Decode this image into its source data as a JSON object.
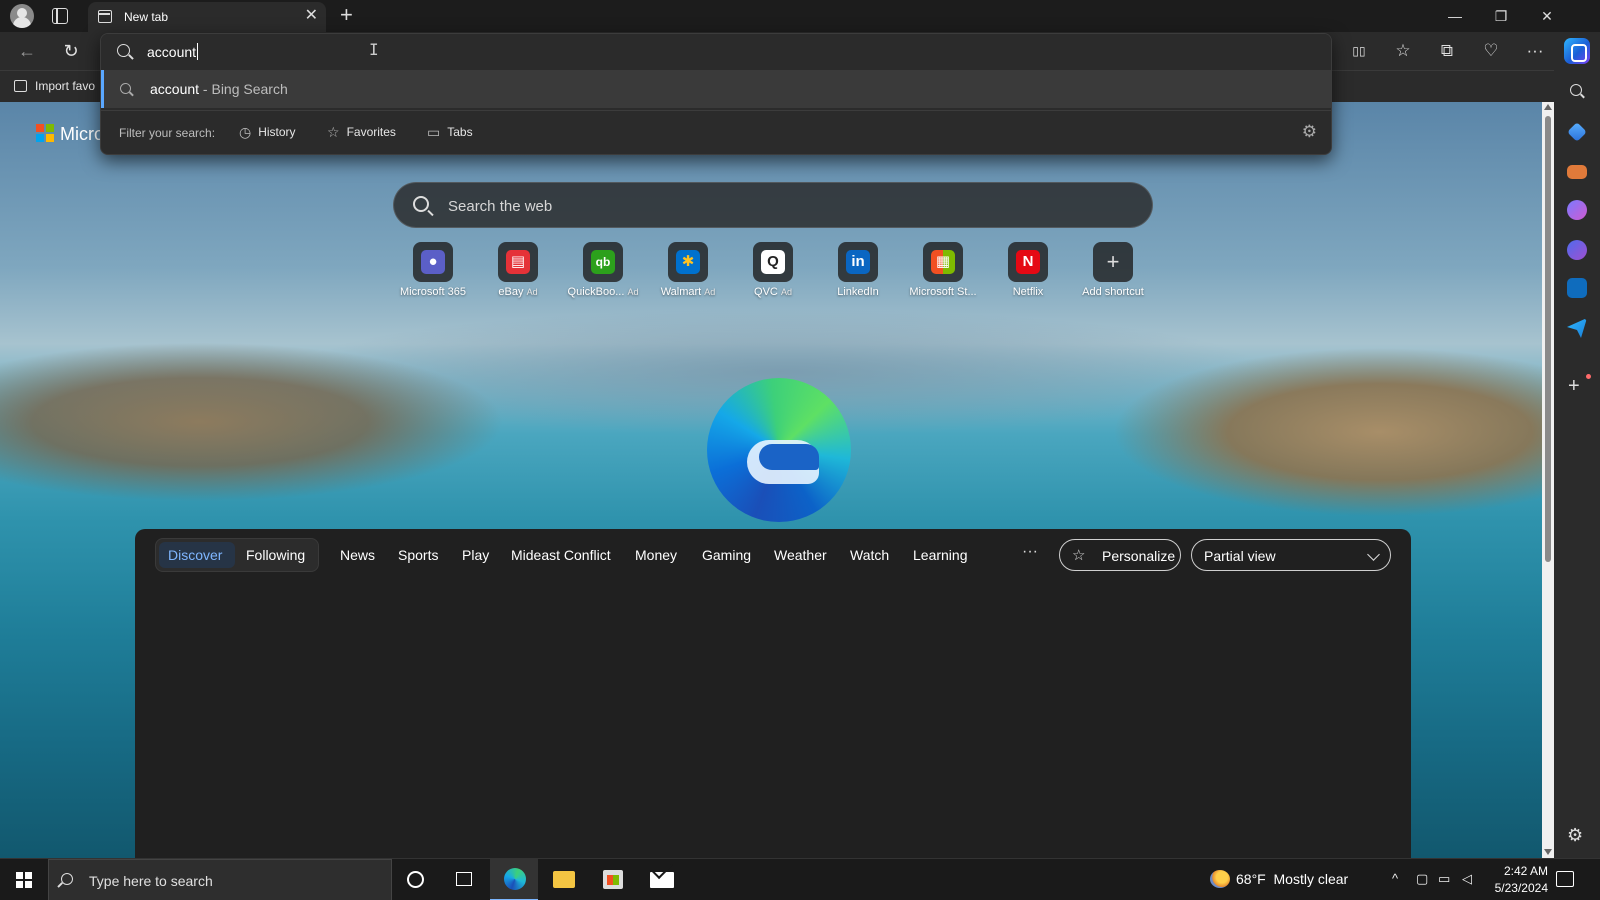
{
  "browser": {
    "tab_title": "New tab",
    "tab_close": "✕",
    "new_tab": "+",
    "window_controls": {
      "minimize": "—",
      "restore": "❐",
      "close": "✕"
    }
  },
  "toolbar": {
    "back_icon": "←",
    "refresh_icon": "↻",
    "split_screen_icon": "▯▯",
    "favorites_icon": "☆",
    "collections_icon": "⧉",
    "performance_icon": "♡",
    "more_icon": "···"
  },
  "favorites_bar": {
    "import_label": "Import favo"
  },
  "omnibox": {
    "value": "account",
    "suggestion_query": "account",
    "suggestion_suffix": " - Bing Search",
    "filter_label": "Filter your search:",
    "filters": [
      {
        "icon": "◷",
        "label": "History"
      },
      {
        "icon": "☆",
        "label": "Favorites"
      },
      {
        "icon": "▭",
        "label": "Tabs"
      }
    ],
    "settings_icon": "⚙"
  },
  "page": {
    "brand_text": "Micro",
    "search_placeholder": "Search the web",
    "shortcuts": [
      {
        "label": "Microsoft 365",
        "ad": "",
        "color": "#5b5fc7",
        "glyph": "●"
      },
      {
        "label": "eBay",
        "ad": "Ad",
        "color": "#e53238",
        "glyph": "▤"
      },
      {
        "label": "QuickBoo...",
        "ad": "Ad",
        "color": "#2ca01c",
        "glyph": "qb"
      },
      {
        "label": "Walmart",
        "ad": "Ad",
        "color": "#0071ce",
        "glyph": "✱"
      },
      {
        "label": "QVC",
        "ad": "Ad",
        "color": "#ffffff",
        "glyph": "Q"
      },
      {
        "label": "LinkedIn",
        "ad": "",
        "color": "#0a66c2",
        "glyph": "in"
      },
      {
        "label": "Microsoft St...",
        "ad": "",
        "color": "#f25022",
        "glyph": "▦"
      },
      {
        "label": "Netflix",
        "ad": "",
        "color": "#e50914",
        "glyph": "N"
      },
      {
        "label": "Add shortcut",
        "ad": "",
        "color": "#3a3a3a",
        "glyph": "+"
      }
    ]
  },
  "feed": {
    "tabs": [
      "Discover",
      "Following"
    ],
    "categories": [
      "News",
      "Sports",
      "Play",
      "Mideast Conflict",
      "Money",
      "Gaming",
      "Weather",
      "Watch",
      "Learning"
    ],
    "more": "···",
    "personalize_label": "Personalize",
    "view_selected": "Partial view"
  },
  "taskbar": {
    "search_placeholder": "Type here to search",
    "weather_temp": "68°F",
    "weather_text": "Mostly clear",
    "time": "2:42 AM",
    "date": "5/23/2024",
    "tray_chevron": "^"
  }
}
